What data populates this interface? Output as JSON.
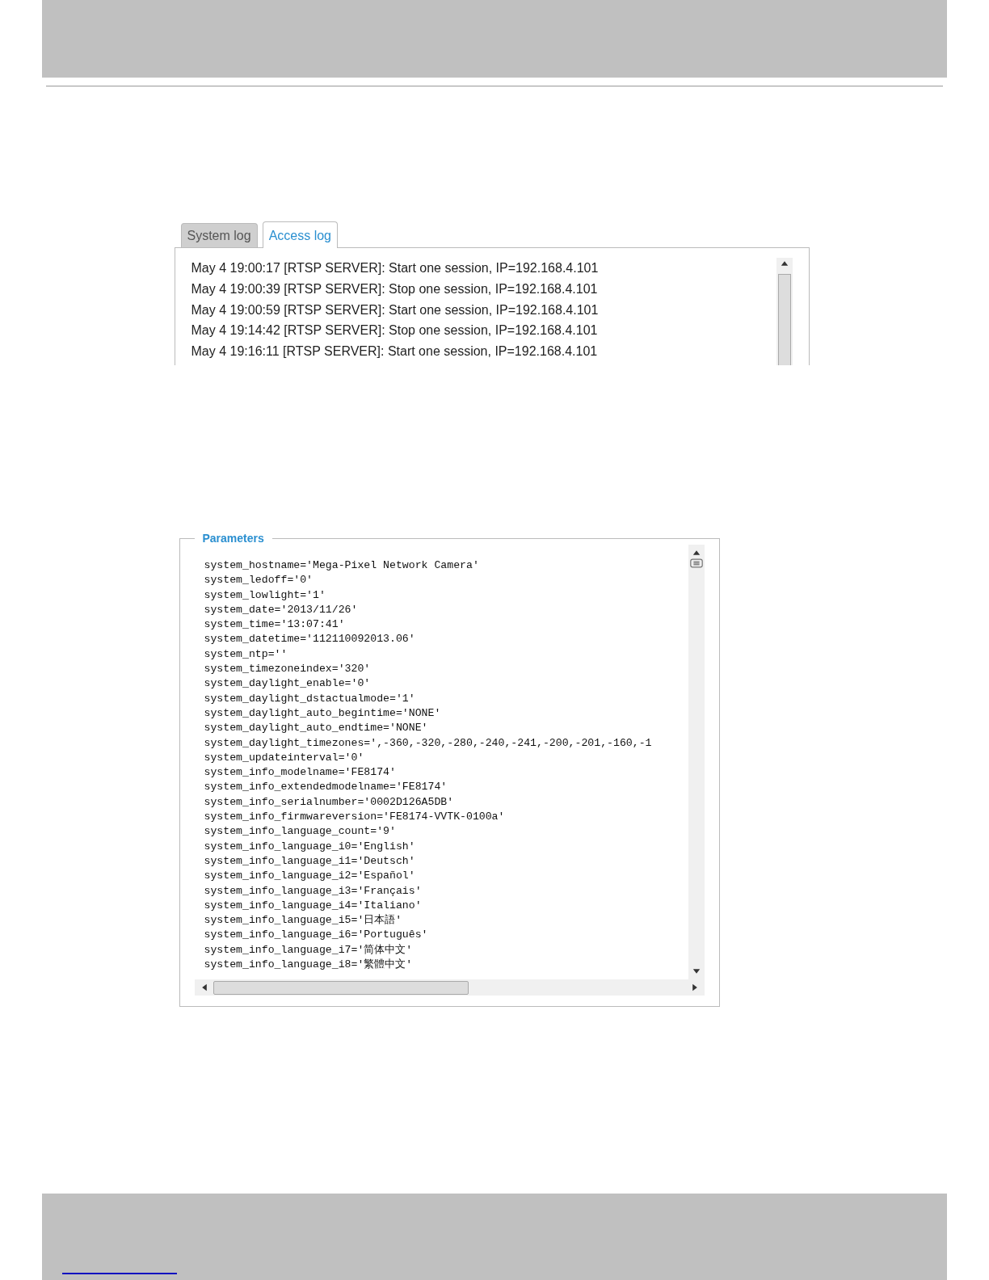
{
  "log_panel": {
    "tabs": [
      {
        "label": "System log",
        "selected": false
      },
      {
        "label": "Access log",
        "selected": true
      }
    ],
    "entries": [
      "May 4 19:00:17 [RTSP SERVER]: Start one session, IP=192.168.4.101",
      "May 4 19:00:39 [RTSP SERVER]: Stop one session, IP=192.168.4.101",
      "May 4 19:00:59 [RTSP SERVER]: Start one session, IP=192.168.4.101",
      "May 4 19:14:42 [RTSP SERVER]: Stop one session, IP=192.168.4.101",
      "May 4 19:16:11 [RTSP SERVER]: Start one session, IP=192.168.4.101"
    ]
  },
  "parameters": {
    "title": "Parameters",
    "lines": [
      "system_hostname='Mega-Pixel Network Camera'",
      "system_ledoff='0'",
      "system_lowlight='1'",
      "system_date='2013/11/26'",
      "system_time='13:07:41'",
      "system_datetime='112110092013.06'",
      "system_ntp=''",
      "system_timezoneindex='320'",
      "system_daylight_enable='0'",
      "system_daylight_dstactualmode='1'",
      "system_daylight_auto_begintime='NONE'",
      "system_daylight_auto_endtime='NONE'",
      "system_daylight_timezones=',-360,-320,-280,-240,-241,-200,-201,-160,-1",
      "system_updateinterval='0'",
      "system_info_modelname='FE8174'",
      "system_info_extendedmodelname='FE8174'",
      "system_info_serialnumber='0002D126A5DB'",
      "system_info_firmwareversion='FE8174-VVTK-0100a'",
      "system_info_language_count='9'",
      "system_info_language_i0='English'",
      "system_info_language_i1='Deutsch'",
      "system_info_language_i2='Español'",
      "system_info_language_i3='Français'",
      "system_info_language_i4='Italiano'",
      "system_info_language_i5='日本語'",
      "system_info_language_i6='Português'",
      "system_info_language_i7='简体中文'",
      "system_info_language_i8='繁體中文'"
    ]
  }
}
